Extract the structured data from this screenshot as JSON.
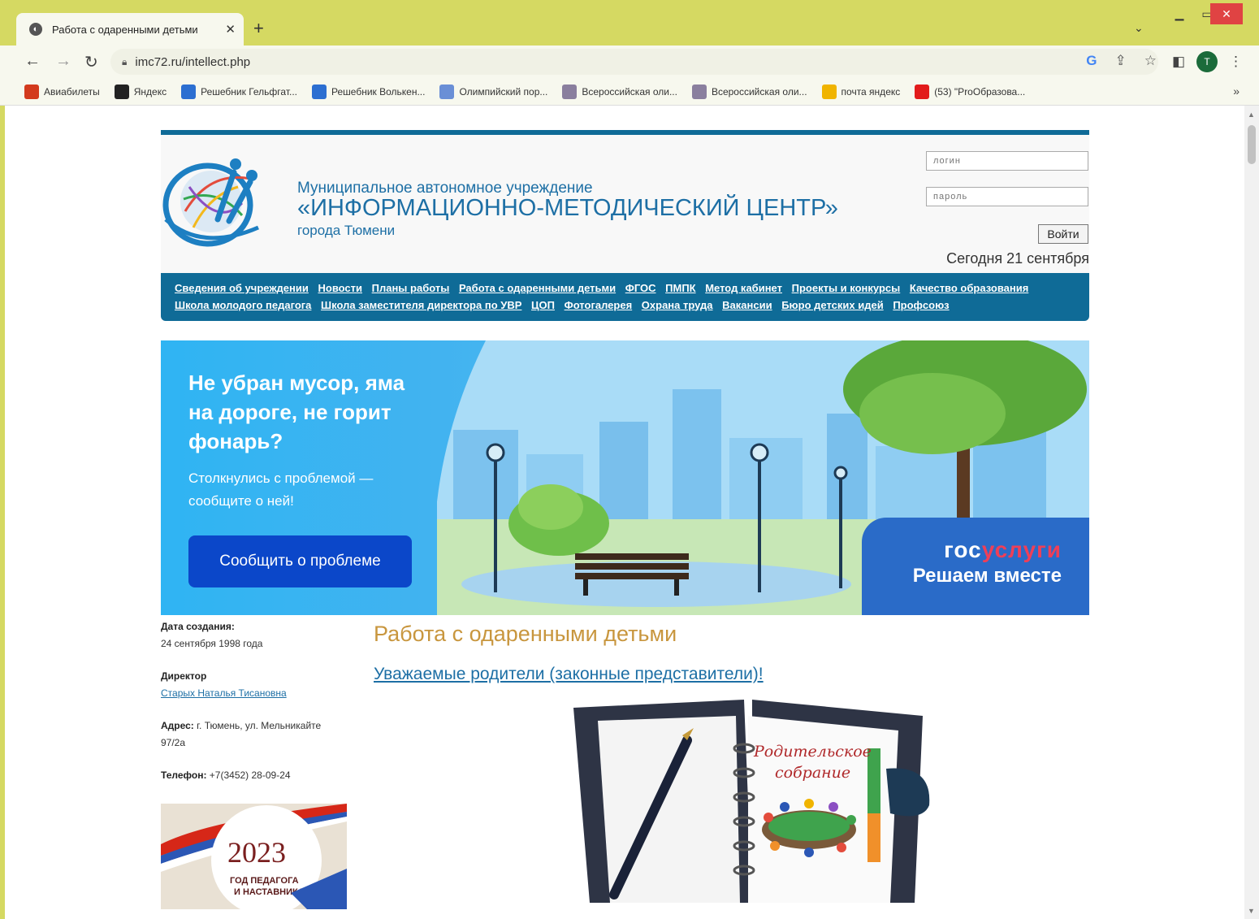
{
  "browser": {
    "tab_title": "Работа с одаренными детьми",
    "url": "imc72.ru/intellect.php",
    "avatar_letter": "T",
    "bookmarks": [
      {
        "label": "Авиабилеты",
        "icon": "travel-bag-icon",
        "color": "#d33a1d"
      },
      {
        "label": "Яндекс",
        "icon": "yandex-icon",
        "color": "#222222"
      },
      {
        "label": "Решебник Гельфгат...",
        "icon": "reshebnik-icon",
        "color": "#2c6fd1"
      },
      {
        "label": "Решебник Волькен...",
        "icon": "reshebnik-icon",
        "color": "#2c6fd1"
      },
      {
        "label": "Олимпийский пор...",
        "icon": "olympiad-icon",
        "color": "#6a8fd6"
      },
      {
        "label": "Всероссийская оли...",
        "icon": "olympiad-emblem-icon",
        "color": "#8a7f9e"
      },
      {
        "label": "Всероссийская оли...",
        "icon": "olympiad-emblem-icon",
        "color": "#8a7f9e"
      },
      {
        "label": "почта яндекс",
        "icon": "mail-icon",
        "color": "#f0b400"
      },
      {
        "label": "(53) \"ProОбразова...",
        "icon": "youtube-icon",
        "color": "#e21b1b"
      }
    ],
    "bookmarks_more": "»"
  },
  "header": {
    "org_line1": "Муниципальное автономное учреждение",
    "org_line2": "«ИНФОРМАЦИОННО-МЕТОДИЧЕСКИЙ ЦЕНТР»",
    "org_line3": "города Тюмени",
    "login_placeholder": "логин",
    "password_placeholder": "пароль",
    "login_button": "Войти",
    "today": "Сегодня 21 сентября"
  },
  "menu": [
    "Сведения об учреждении",
    "Новости",
    "Планы работы",
    "Работа с одаренными детьми",
    "ФГОС",
    "ПМПК",
    "Метод кабинет",
    "Проекты и конкурсы",
    "Качество образования",
    "Школа молодого педагога",
    "Школа заместителя директора по УВР",
    "ЦОП",
    "Фотогалерея",
    "Охрана труда",
    "Вакансии",
    "Бюро детских идей",
    "Профсоюз"
  ],
  "banner": {
    "headline": "Не убран мусор, яма на дороге, не горит фонарь?",
    "subtext": "Столкнулись с проблемой — сообщите о ней!",
    "button": "Сообщить о проблеме",
    "brand_part1": "гос",
    "brand_part2": "услуги",
    "slogan": "Решаем вместе"
  },
  "sidebar": {
    "created_label": "Дата создания:",
    "created_value": "24 сентября 1998 года",
    "director_label": "Директор",
    "director_name": "Старых Наталья Тисановна",
    "address_label": "Адрес:",
    "address_value": " г. Тюмень, ул. Мельникайте 97/2а",
    "phone_label": "Телефон:",
    "phone_value": " +7(3452) 28-09-24",
    "year_badge": "ГОД ПЕДАГОГА И НАСТАВНИКА",
    "year_number": "2023"
  },
  "main": {
    "title": "Работа с одаренными детьми",
    "lead_link": "Уважаемые родители (законные представители)!",
    "image_caption_1": "Родительское",
    "image_caption_2": "собрание"
  },
  "colors": {
    "chrome": "#d5d962",
    "site_blue": "#0f6b97",
    "link_blue": "#1d6fa5",
    "title_gold": "#c8963e",
    "banner_btn": "#0b47c9"
  }
}
